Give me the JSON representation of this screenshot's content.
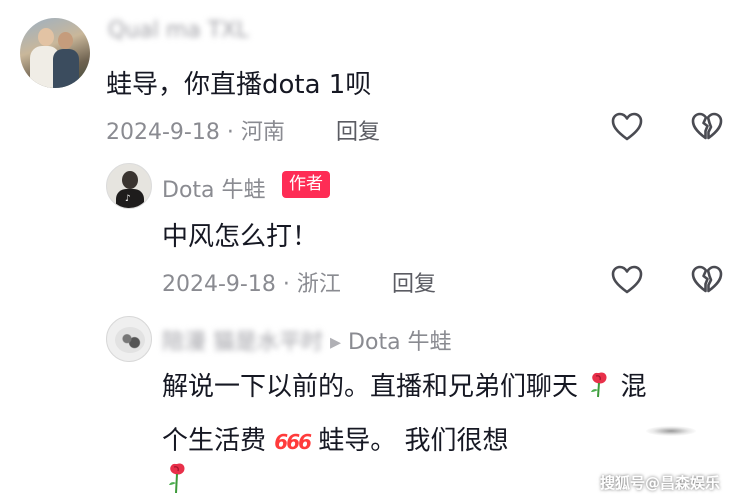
{
  "comments": [
    {
      "username": "Qual ma TXL",
      "text": "蛙导，你直播dota 1呗",
      "date_location": "2024-9-18 · 河南",
      "reply_label": "回复"
    },
    {
      "username": "Dota 牛蛙",
      "author_tag": "作者",
      "text": "中风怎么打！",
      "date_location": "2024-9-18 · 浙江",
      "reply_label": "回复"
    },
    {
      "username": "陪漫 猫是水平时",
      "reply_to": "Dota 牛蛙",
      "text_line1": "解说一下以前的。直播和兄弟们聊天",
      "text_line1_suffix": "混",
      "text_line2_a": "个生活费",
      "text_line2_emoji": "666",
      "text_line2_b": "蛙导。 我们很想"
    }
  ],
  "watermark": "搜狐号@昌森娱乐",
  "icons": [
    "heart-outline-icon",
    "broken-heart-outline-icon",
    "rose-emoji-icon"
  ],
  "colors": {
    "author_tag_bg": "#fe2c55",
    "text": "#161823",
    "meta": "#8a8b91"
  }
}
